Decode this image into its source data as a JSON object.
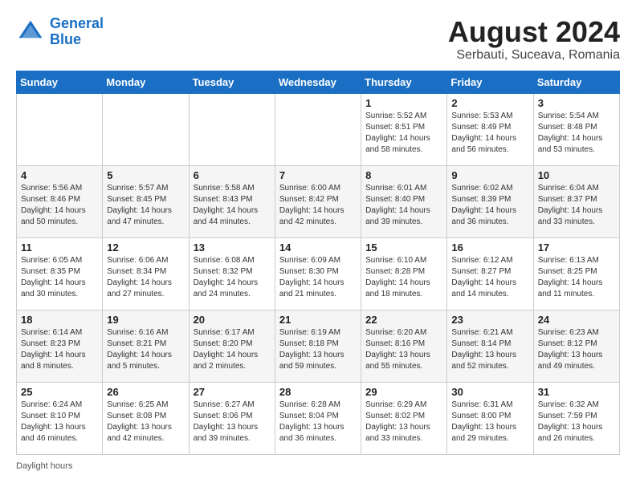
{
  "header": {
    "logo_line1": "General",
    "logo_line2": "Blue",
    "month_year": "August 2024",
    "location": "Serbauti, Suceava, Romania"
  },
  "days_of_week": [
    "Sunday",
    "Monday",
    "Tuesday",
    "Wednesday",
    "Thursday",
    "Friday",
    "Saturday"
  ],
  "weeks": [
    [
      {
        "day": "",
        "info": ""
      },
      {
        "day": "",
        "info": ""
      },
      {
        "day": "",
        "info": ""
      },
      {
        "day": "",
        "info": ""
      },
      {
        "day": "1",
        "info": "Sunrise: 5:52 AM\nSunset: 8:51 PM\nDaylight: 14 hours\nand 58 minutes."
      },
      {
        "day": "2",
        "info": "Sunrise: 5:53 AM\nSunset: 8:49 PM\nDaylight: 14 hours\nand 56 minutes."
      },
      {
        "day": "3",
        "info": "Sunrise: 5:54 AM\nSunset: 8:48 PM\nDaylight: 14 hours\nand 53 minutes."
      }
    ],
    [
      {
        "day": "4",
        "info": "Sunrise: 5:56 AM\nSunset: 8:46 PM\nDaylight: 14 hours\nand 50 minutes."
      },
      {
        "day": "5",
        "info": "Sunrise: 5:57 AM\nSunset: 8:45 PM\nDaylight: 14 hours\nand 47 minutes."
      },
      {
        "day": "6",
        "info": "Sunrise: 5:58 AM\nSunset: 8:43 PM\nDaylight: 14 hours\nand 44 minutes."
      },
      {
        "day": "7",
        "info": "Sunrise: 6:00 AM\nSunset: 8:42 PM\nDaylight: 14 hours\nand 42 minutes."
      },
      {
        "day": "8",
        "info": "Sunrise: 6:01 AM\nSunset: 8:40 PM\nDaylight: 14 hours\nand 39 minutes."
      },
      {
        "day": "9",
        "info": "Sunrise: 6:02 AM\nSunset: 8:39 PM\nDaylight: 14 hours\nand 36 minutes."
      },
      {
        "day": "10",
        "info": "Sunrise: 6:04 AM\nSunset: 8:37 PM\nDaylight: 14 hours\nand 33 minutes."
      }
    ],
    [
      {
        "day": "11",
        "info": "Sunrise: 6:05 AM\nSunset: 8:35 PM\nDaylight: 14 hours\nand 30 minutes."
      },
      {
        "day": "12",
        "info": "Sunrise: 6:06 AM\nSunset: 8:34 PM\nDaylight: 14 hours\nand 27 minutes."
      },
      {
        "day": "13",
        "info": "Sunrise: 6:08 AM\nSunset: 8:32 PM\nDaylight: 14 hours\nand 24 minutes."
      },
      {
        "day": "14",
        "info": "Sunrise: 6:09 AM\nSunset: 8:30 PM\nDaylight: 14 hours\nand 21 minutes."
      },
      {
        "day": "15",
        "info": "Sunrise: 6:10 AM\nSunset: 8:28 PM\nDaylight: 14 hours\nand 18 minutes."
      },
      {
        "day": "16",
        "info": "Sunrise: 6:12 AM\nSunset: 8:27 PM\nDaylight: 14 hours\nand 14 minutes."
      },
      {
        "day": "17",
        "info": "Sunrise: 6:13 AM\nSunset: 8:25 PM\nDaylight: 14 hours\nand 11 minutes."
      }
    ],
    [
      {
        "day": "18",
        "info": "Sunrise: 6:14 AM\nSunset: 8:23 PM\nDaylight: 14 hours\nand 8 minutes."
      },
      {
        "day": "19",
        "info": "Sunrise: 6:16 AM\nSunset: 8:21 PM\nDaylight: 14 hours\nand 5 minutes."
      },
      {
        "day": "20",
        "info": "Sunrise: 6:17 AM\nSunset: 8:20 PM\nDaylight: 14 hours\nand 2 minutes."
      },
      {
        "day": "21",
        "info": "Sunrise: 6:19 AM\nSunset: 8:18 PM\nDaylight: 13 hours\nand 59 minutes."
      },
      {
        "day": "22",
        "info": "Sunrise: 6:20 AM\nSunset: 8:16 PM\nDaylight: 13 hours\nand 55 minutes."
      },
      {
        "day": "23",
        "info": "Sunrise: 6:21 AM\nSunset: 8:14 PM\nDaylight: 13 hours\nand 52 minutes."
      },
      {
        "day": "24",
        "info": "Sunrise: 6:23 AM\nSunset: 8:12 PM\nDaylight: 13 hours\nand 49 minutes."
      }
    ],
    [
      {
        "day": "25",
        "info": "Sunrise: 6:24 AM\nSunset: 8:10 PM\nDaylight: 13 hours\nand 46 minutes."
      },
      {
        "day": "26",
        "info": "Sunrise: 6:25 AM\nSunset: 8:08 PM\nDaylight: 13 hours\nand 42 minutes."
      },
      {
        "day": "27",
        "info": "Sunrise: 6:27 AM\nSunset: 8:06 PM\nDaylight: 13 hours\nand 39 minutes."
      },
      {
        "day": "28",
        "info": "Sunrise: 6:28 AM\nSunset: 8:04 PM\nDaylight: 13 hours\nand 36 minutes."
      },
      {
        "day": "29",
        "info": "Sunrise: 6:29 AM\nSunset: 8:02 PM\nDaylight: 13 hours\nand 33 minutes."
      },
      {
        "day": "30",
        "info": "Sunrise: 6:31 AM\nSunset: 8:00 PM\nDaylight: 13 hours\nand 29 minutes."
      },
      {
        "day": "31",
        "info": "Sunrise: 6:32 AM\nSunset: 7:59 PM\nDaylight: 13 hours\nand 26 minutes."
      }
    ]
  ],
  "footer": {
    "text": "Daylight hours"
  }
}
